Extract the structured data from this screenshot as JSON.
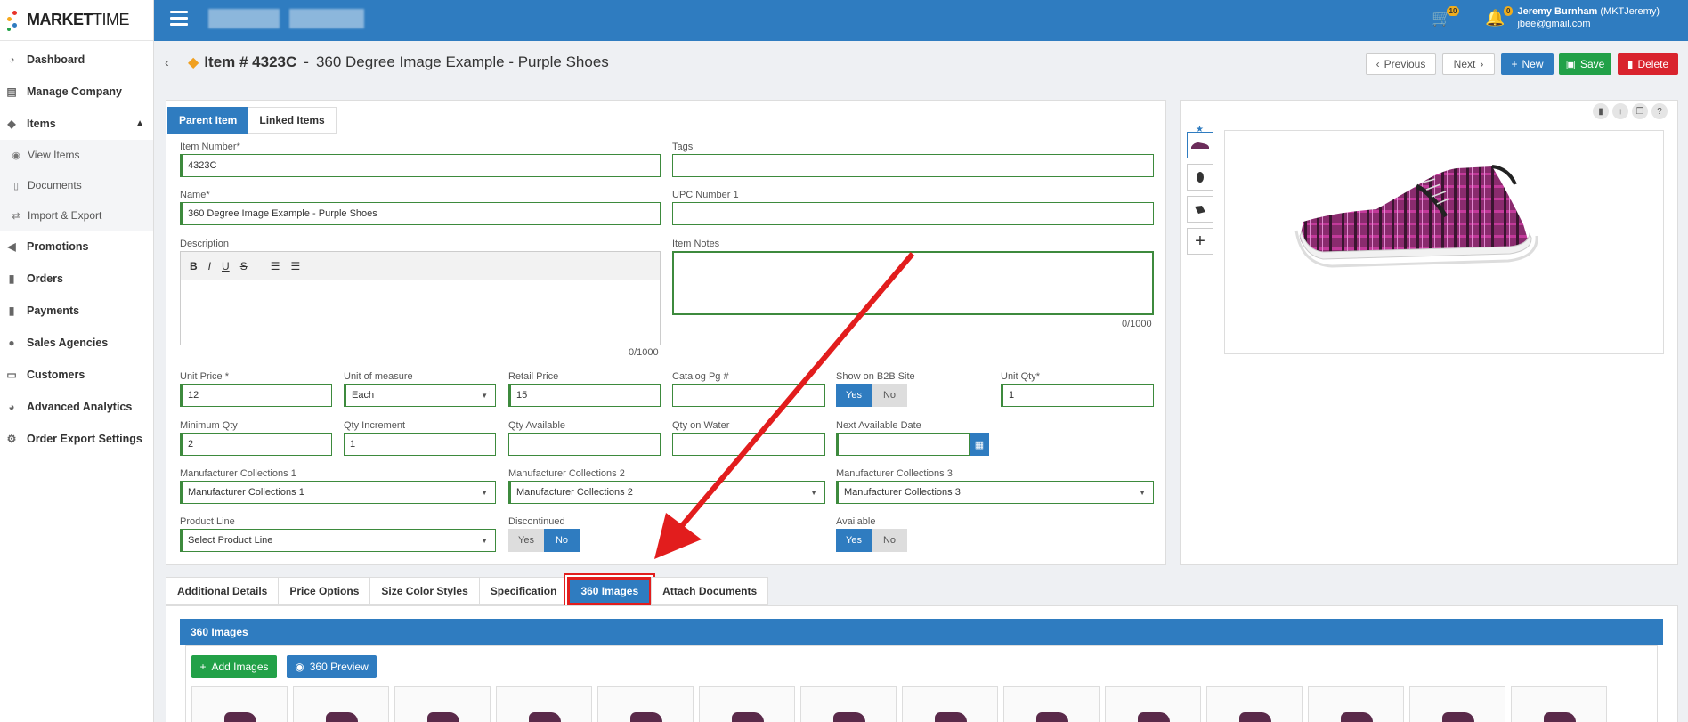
{
  "app": {
    "logo_bold": "MARKET",
    "logo_light": "TIME"
  },
  "sidebar": {
    "items": [
      {
        "label": "Dashboard",
        "icon": "dashboard-icon"
      },
      {
        "label": "Manage Company",
        "icon": "company-icon"
      },
      {
        "label": "Items",
        "icon": "tags-icon"
      },
      {
        "label": "Promotions",
        "icon": "megaphone-icon"
      },
      {
        "label": "Orders",
        "icon": "file-icon"
      },
      {
        "label": "Payments",
        "icon": "file-icon"
      },
      {
        "label": "Sales Agencies",
        "icon": "users-icon"
      },
      {
        "label": "Customers",
        "icon": "id-card-icon"
      },
      {
        "label": "Advanced Analytics",
        "icon": "pie-chart-icon"
      },
      {
        "label": "Order Export Settings",
        "icon": "gears-icon"
      }
    ],
    "sub_items": [
      {
        "label": "View Items",
        "icon": "eye-icon"
      },
      {
        "label": "Documents",
        "icon": "document-icon"
      },
      {
        "label": "Import & Export",
        "icon": "exchange-icon"
      }
    ]
  },
  "topbar": {
    "cart_count": "10",
    "bell_count": "0",
    "user_name": "Jeremy Burnham",
    "user_code": "(MKTJeremy)",
    "user_email": "jbee@gmail.com"
  },
  "header": {
    "item_prefix": "Item # 4323C",
    "separator": "-",
    "item_name": "360 Degree Image Example - Purple Shoes",
    "previous": "Previous",
    "next": "Next",
    "new": "New",
    "save": "Save",
    "delete": "Delete"
  },
  "tabs_top": [
    "Parent Item",
    "Linked Items"
  ],
  "form": {
    "item_number_label": "Item Number*",
    "item_number": "4323C",
    "tags_label": "Tags",
    "tags": "",
    "name_label": "Name*",
    "name": "360 Degree Image Example - Purple Shoes",
    "upc_label": "UPC Number 1",
    "upc": "",
    "description_label": "Description",
    "description_count": "0/1000",
    "notes_label": "Item Notes",
    "notes_count": "0/1000",
    "unit_price_label": "Unit Price *",
    "unit_price": "12",
    "uom_label": "Unit of measure",
    "uom": "Each",
    "retail_label": "Retail Price",
    "retail": "15",
    "catalog_label": "Catalog Pg #",
    "catalog": "",
    "b2b_label": "Show on B2B Site",
    "yes": "Yes",
    "no": "No",
    "unit_qty_label": "Unit Qty*",
    "unit_qty": "1",
    "min_qty_label": "Minimum Qty",
    "min_qty": "2",
    "qty_inc_label": "Qty Increment",
    "qty_inc": "1",
    "qty_avail_label": "Qty Available",
    "qty_avail": "",
    "qty_water_label": "Qty on Water",
    "qty_water": "",
    "next_date_label": "Next Available Date",
    "next_date": "",
    "mc1_label": "Manufacturer Collections 1",
    "mc1": "Manufacturer Collections 1",
    "mc2_label": "Manufacturer Collections 2",
    "mc2": "Manufacturer Collections 2",
    "mc3_label": "Manufacturer Collections 3",
    "mc3": "Manufacturer Collections 3",
    "product_line_label": "Product Line",
    "product_line": "Select Product Line",
    "discontinued_label": "Discontinued",
    "available_label": "Available"
  },
  "tabs_bottom": [
    "Additional Details",
    "Price Options",
    "Size Color Styles",
    "Specification",
    "360 Images",
    "Attach Documents"
  ],
  "images_panel": {
    "title": "360 Images",
    "add": "Add Images",
    "preview": "360 Preview"
  },
  "colors": {
    "primary": "#2f7cc0",
    "save": "#22a148",
    "delete": "#d9232d",
    "annotation": "#e21d1d"
  }
}
